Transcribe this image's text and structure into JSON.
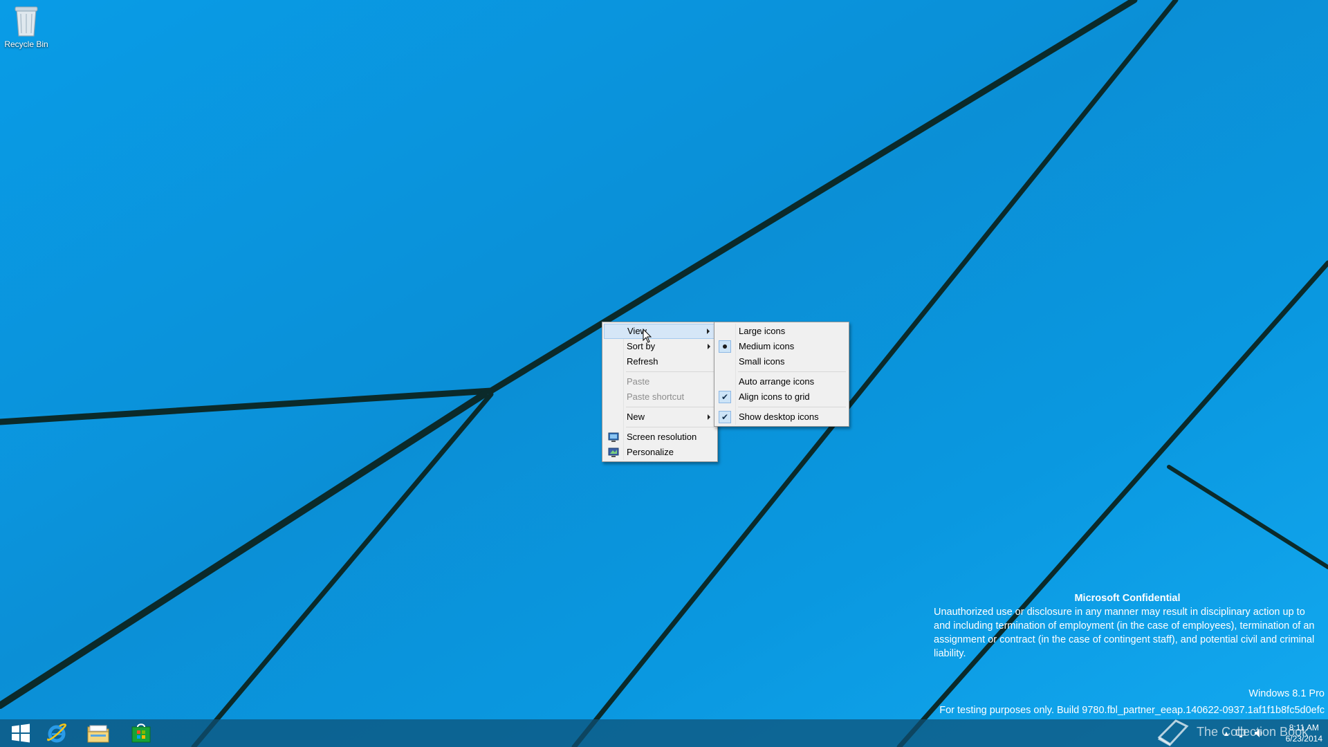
{
  "desktop": {
    "icons": [
      {
        "label": "Recycle Bin",
        "icon": "recycle-bin-icon"
      }
    ]
  },
  "context_menu": {
    "items": [
      {
        "label": "View",
        "submenu": true,
        "state": "hover"
      },
      {
        "label": "Sort by",
        "submenu": true
      },
      {
        "label": "Refresh"
      },
      {
        "label": "Paste",
        "disabled": true
      },
      {
        "label": "Paste shortcut",
        "disabled": true
      },
      {
        "label": "New",
        "submenu": true
      },
      {
        "label": "Screen resolution",
        "icon": "screen-resolution-icon"
      },
      {
        "label": "Personalize",
        "icon": "personalize-icon"
      }
    ]
  },
  "view_submenu": {
    "items": [
      {
        "label": "Large icons"
      },
      {
        "label": "Medium icons",
        "selected": "radio"
      },
      {
        "label": "Small icons"
      },
      {
        "label": "Auto arrange icons"
      },
      {
        "label": "Align icons to grid",
        "checked": true
      },
      {
        "label": "Show desktop icons",
        "checked": true
      }
    ]
  },
  "watermark": {
    "title": "Microsoft Confidential",
    "body": "Unauthorized use or disclosure in any manner may result in disciplinary action up to and including termination of employment (in the case of employees), termination of an assignment or contract (in the case of contingent staff), and potential civil and criminal liability.",
    "edition": "Windows 8.1 Pro",
    "build": "For testing purposes only. Build 9780.fbl_partner_eeap.140622-0937.1af1f1b8fc5d0efc"
  },
  "taskbar": {
    "apps": [
      "start-icon",
      "internet-explorer-icon",
      "file-explorer-icon",
      "store-icon"
    ],
    "clock": {
      "time": "8:11 AM",
      "date": "6/23/2014"
    },
    "brand": "The Collection Book"
  },
  "colors": {
    "wallpaper": "#0f9fe6",
    "menu_bg": "#f0f0f0",
    "menu_hover": "#d5e6f7"
  }
}
